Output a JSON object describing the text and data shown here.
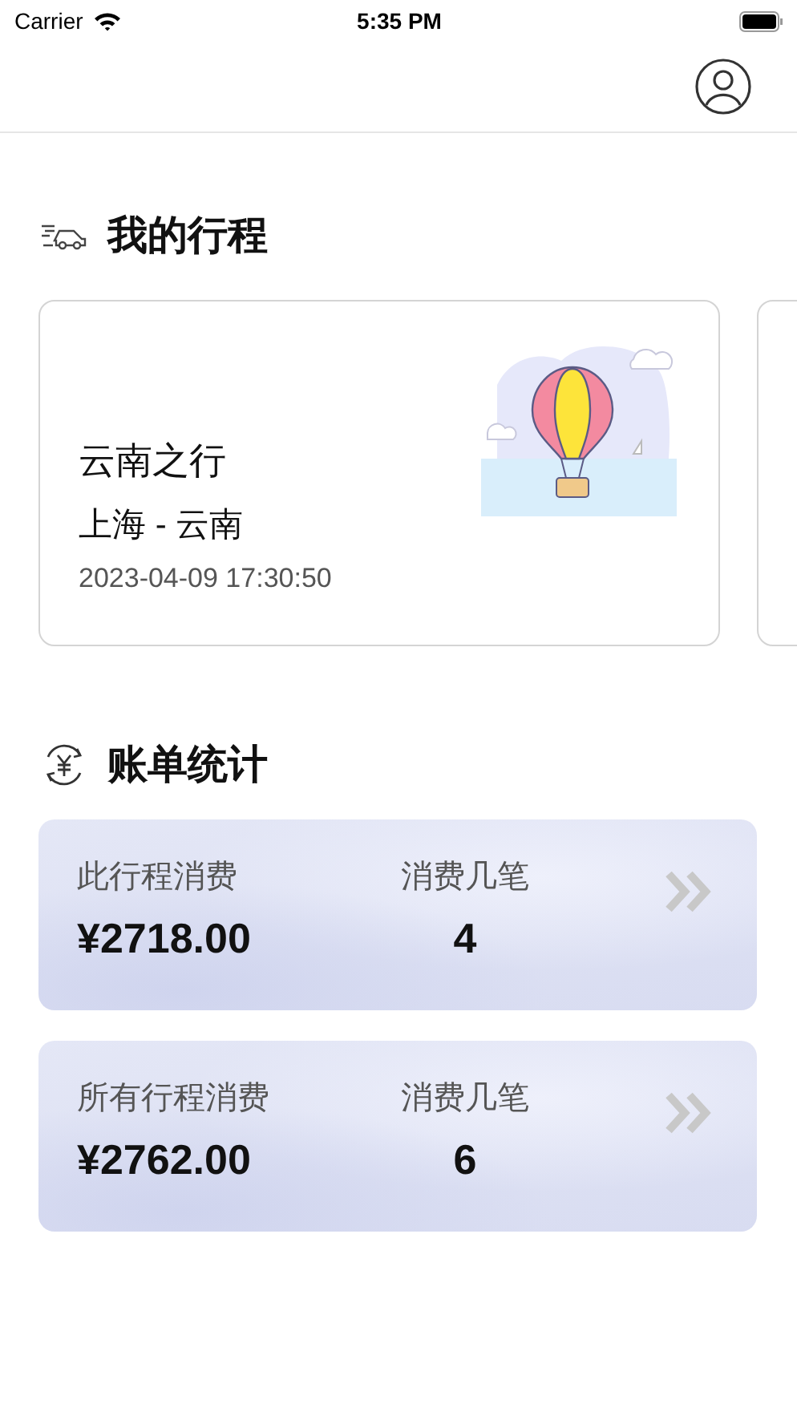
{
  "status_bar": {
    "carrier": "Carrier",
    "time": "5:35 PM"
  },
  "sections": [
    {
      "kind": "trips",
      "title": "我的行程"
    },
    {
      "kind": "bills",
      "title": "账单统计"
    }
  ],
  "trips": [
    {
      "kind": "trip",
      "name": "云南之行",
      "route": "上海 - 云南",
      "date": "2023-04-09 17:30:50"
    },
    {
      "kind": "peek"
    }
  ],
  "bills": [
    {
      "spend_label": "此行程消费",
      "amount": "¥2718.00",
      "count_label": "消费几笔",
      "count": "4"
    },
    {
      "spend_label": "所有行程消费",
      "amount": "¥2762.00",
      "count_label": "消费几笔",
      "count": "6"
    }
  ]
}
